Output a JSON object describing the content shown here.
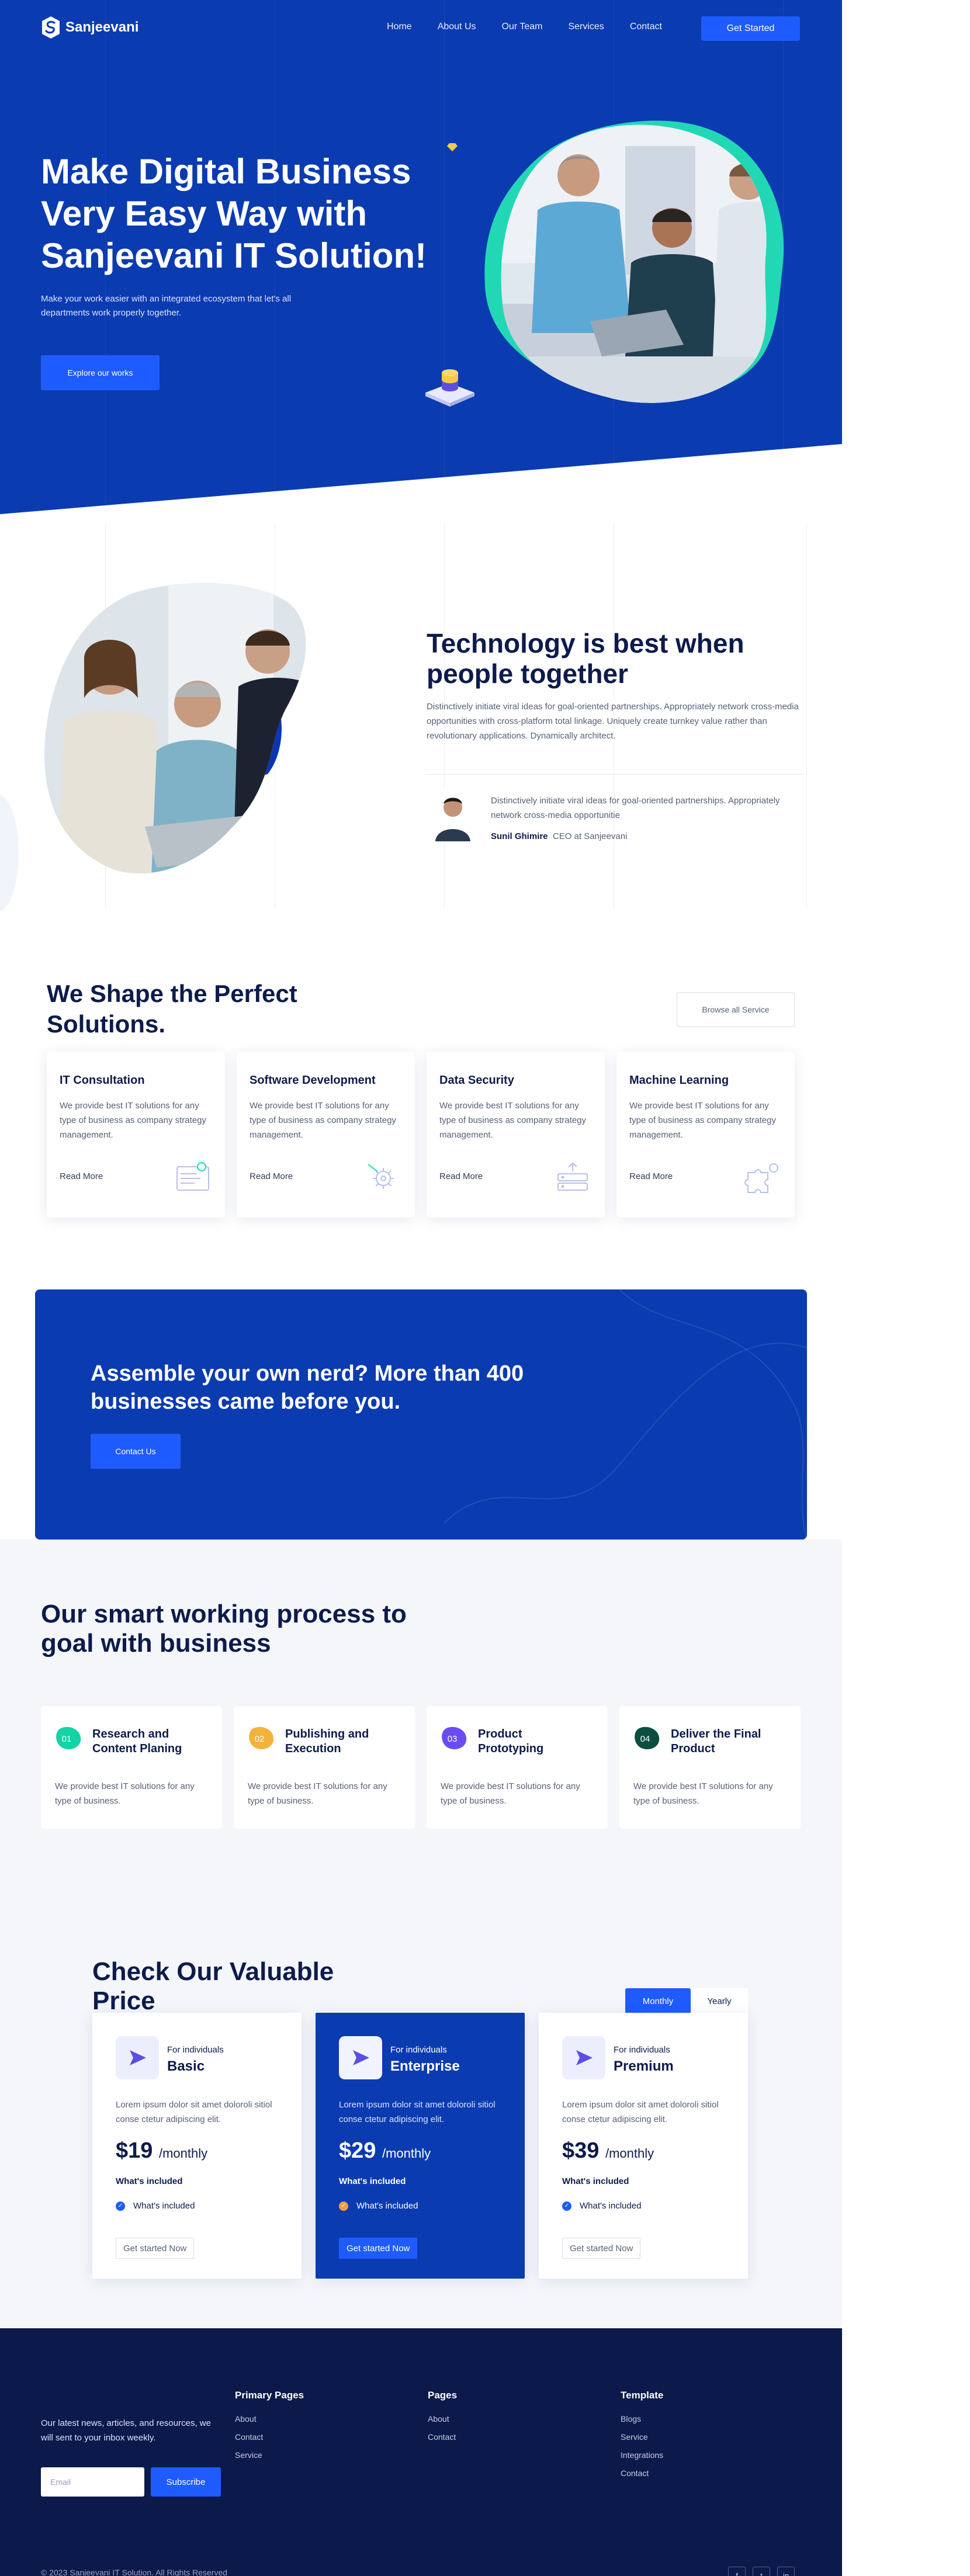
{
  "brand": {
    "name": "Sanjeevani",
    "primary": "#1f5cff",
    "hero_bg": "#0b3bb0",
    "footer_bg": "#0b1a4a"
  },
  "nav": {
    "items": [
      {
        "label": "Home"
      },
      {
        "label": "About Us"
      },
      {
        "label": "Our Team"
      },
      {
        "label": "Services"
      },
      {
        "label": "Contact"
      }
    ],
    "cta_label": "Get Started"
  },
  "hero": {
    "title": "Make Digital Business Very Easy Way with Sanjeevani IT Solution!",
    "subtitle": "Make your work easier with an integrated ecosystem that let's all departments work properly together.",
    "button_label": "Explore our works"
  },
  "about": {
    "title": "Technology is best when people together",
    "text": "Distinctively initiate viral ideas for goal-oriented partnerships. Appropriately network cross-media opportunities with cross-platform total linkage. Uniquely create turnkey value rather than revolutionary applications. Dynamically architect.",
    "quote": "Distinctively initiate viral ideas for goal-oriented partnerships. Appropriately network cross-media opportunitie",
    "author_name": "Sunil Ghimire",
    "author_role": "CEO at Sanjeevani"
  },
  "solutions": {
    "title": "We Shape the Perfect Solutions.",
    "browse_label": "Browse all Service",
    "cards": [
      {
        "title": "IT Consultation",
        "text": "We provide best IT solutions for any type of business as company strategy management.",
        "link": "Read More",
        "icon": "monitor-icon"
      },
      {
        "title": "Software Development",
        "text": "We provide best IT solutions for any type of business as company strategy management.",
        "link": "Read More",
        "icon": "gear-icon"
      },
      {
        "title": "Data Security",
        "text": "We provide best IT solutions for any type of business as company strategy management.",
        "link": "Read More",
        "icon": "server-icon"
      },
      {
        "title": "Machine Learning",
        "text": "We provide best IT solutions for any type of business as company strategy management.",
        "link": "Read More",
        "icon": "puzzle-icon"
      }
    ]
  },
  "cta": {
    "title": "Assemble your own nerd? More than 400 businesses came before you.",
    "button_label": "Contact Us"
  },
  "process": {
    "title": "Our smart working process to goal with business",
    "steps": [
      {
        "num": "01",
        "title": "Research and Content Planing",
        "text": "We provide best IT solutions for any type of business.",
        "color": "#14d3a6"
      },
      {
        "num": "02",
        "title": "Publishing and Execution",
        "text": "We provide best IT solutions for any type of business.",
        "color": "#f5b23b"
      },
      {
        "num": "03",
        "title": "Product Prototyping",
        "text": "We provide best IT solutions for any type of business.",
        "color": "#6a4df2"
      },
      {
        "num": "04",
        "title": "Deliver the Final Product",
        "text": "We provide best IT solutions for any type of business.",
        "color": "#0b4f3f"
      }
    ]
  },
  "pricing": {
    "title": "Check Our Valuable Price",
    "toggle": {
      "monthly": "Monthly",
      "yearly": "Yearly"
    },
    "plans": [
      {
        "for": "For individuals",
        "name": "Basic",
        "desc": "Lorem ipsum dolor sit amet doloroli sitiol conse ctetur adipiscing elit.",
        "price": "$19",
        "period": "/monthly",
        "included_title": "What's included",
        "feature": "What's included",
        "button": "Get started Now"
      },
      {
        "for": "For individuals",
        "name": "Enterprise",
        "desc": "Lorem ipsum dolor sit amet doloroli sitiol conse ctetur adipiscing elit.",
        "price": "$29",
        "period": "/monthly",
        "included_title": "What's included",
        "feature": "What's included",
        "button": "Get started Now"
      },
      {
        "for": "For individuals",
        "name": "Premium",
        "desc": "Lorem ipsum dolor sit amet doloroli sitiol conse ctetur adipiscing elit.",
        "price": "$39",
        "period": "/monthly",
        "included_title": "What's included",
        "feature": "What's included",
        "button": "Get started Now"
      }
    ]
  },
  "footer": {
    "newsletter_text": "Our latest news, articles, and resources, we will sent to your inbox weekly.",
    "email_placeholder": "Email",
    "subscribe_label": "Subscribe",
    "columns": [
      {
        "title": "Primary Pages",
        "links": [
          "About",
          "Contact",
          "Service"
        ]
      },
      {
        "title": "Pages",
        "links": [
          "About",
          "Contact"
        ]
      },
      {
        "title": "Template",
        "links": [
          "Blogs",
          "Service",
          "Integrations",
          "Contact"
        ]
      }
    ],
    "copyright": "© 2023 Sanjeevani IT Solution. All Rights Reserved",
    "social": [
      {
        "label": "f",
        "icon": "facebook-icon"
      },
      {
        "label": "t",
        "icon": "twitter-icon"
      },
      {
        "label": "in",
        "icon": "linkedin-icon"
      }
    ]
  }
}
